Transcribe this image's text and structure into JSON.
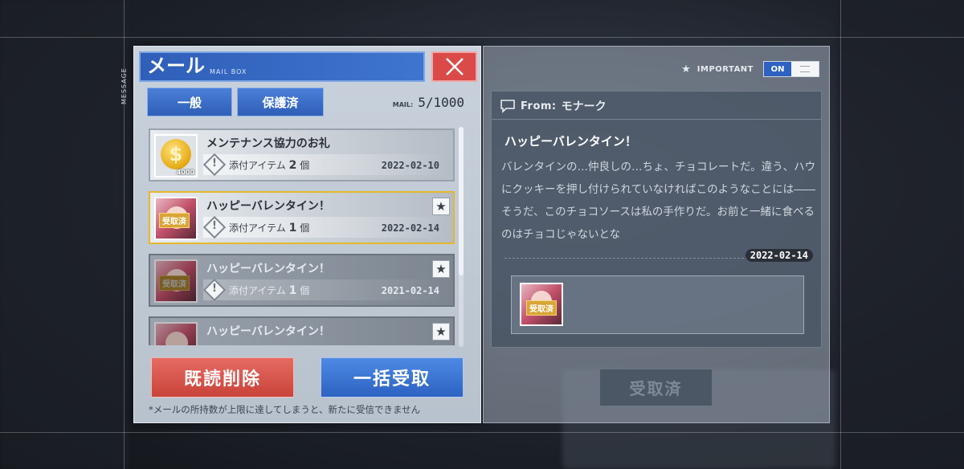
{
  "side_label": "MESSAGE",
  "mail": {
    "title": "メール",
    "subtitle": "MAIL BOX",
    "tabs": [
      "一般",
      "保護済"
    ],
    "count_label": "MAIL:",
    "count_value": "5/1000",
    "items": [
      {
        "title": "メンテナンス協力のお礼",
        "attach_label": "添付アイテム",
        "attach_count": "2",
        "attach_unit": "個",
        "date": "2022-02-10",
        "thumb": "coin",
        "qty": "4000",
        "received": false,
        "starred": false
      },
      {
        "title": "ハッピーバレンタイン！",
        "attach_label": "添付アイテム",
        "attach_count": "1",
        "attach_unit": "個",
        "date": "2022-02-14",
        "thumb": "chocolate",
        "received_label": "受取済",
        "received": true,
        "starred": true
      },
      {
        "title": "ハッピーバレンタイン！",
        "attach_label": "添付アイテム",
        "attach_count": "1",
        "attach_unit": "個",
        "date": "2021-02-14",
        "thumb": "chocolate",
        "received_label": "受取済",
        "received": true,
        "starred": true
      },
      {
        "title": "ハッピーバレンタイン！",
        "received": true,
        "starred": true
      }
    ],
    "delete_read_label": "既読削除",
    "bulk_receive_label": "一括受取",
    "footnote": "*メールの所持数が上限に達してしまうと、新たに受信できません"
  },
  "detail": {
    "important_label": "IMPORTANT",
    "toggle_on_label": "ON",
    "from_label": "From:",
    "from_name": "モナーク",
    "title": "ハッピーバレンタイン！",
    "body": "バレンタインの…仲良しの…ちょ、チョコレートだ。違う、ハウにクッキーを押し付けられていなければこのようなことには――そうだ、このチョコソースは私の手作りだ。お前と一緒に食べるのはチョコじゃないとな",
    "date": "2022-02-14",
    "attachment_badge": "受取済",
    "received_button_label": "受取済"
  },
  "colors": {
    "accent_blue": "#2d62c2",
    "danger_red": "#d94a48",
    "selected_border": "#e4b82a",
    "received_badge": "#d8a536"
  }
}
